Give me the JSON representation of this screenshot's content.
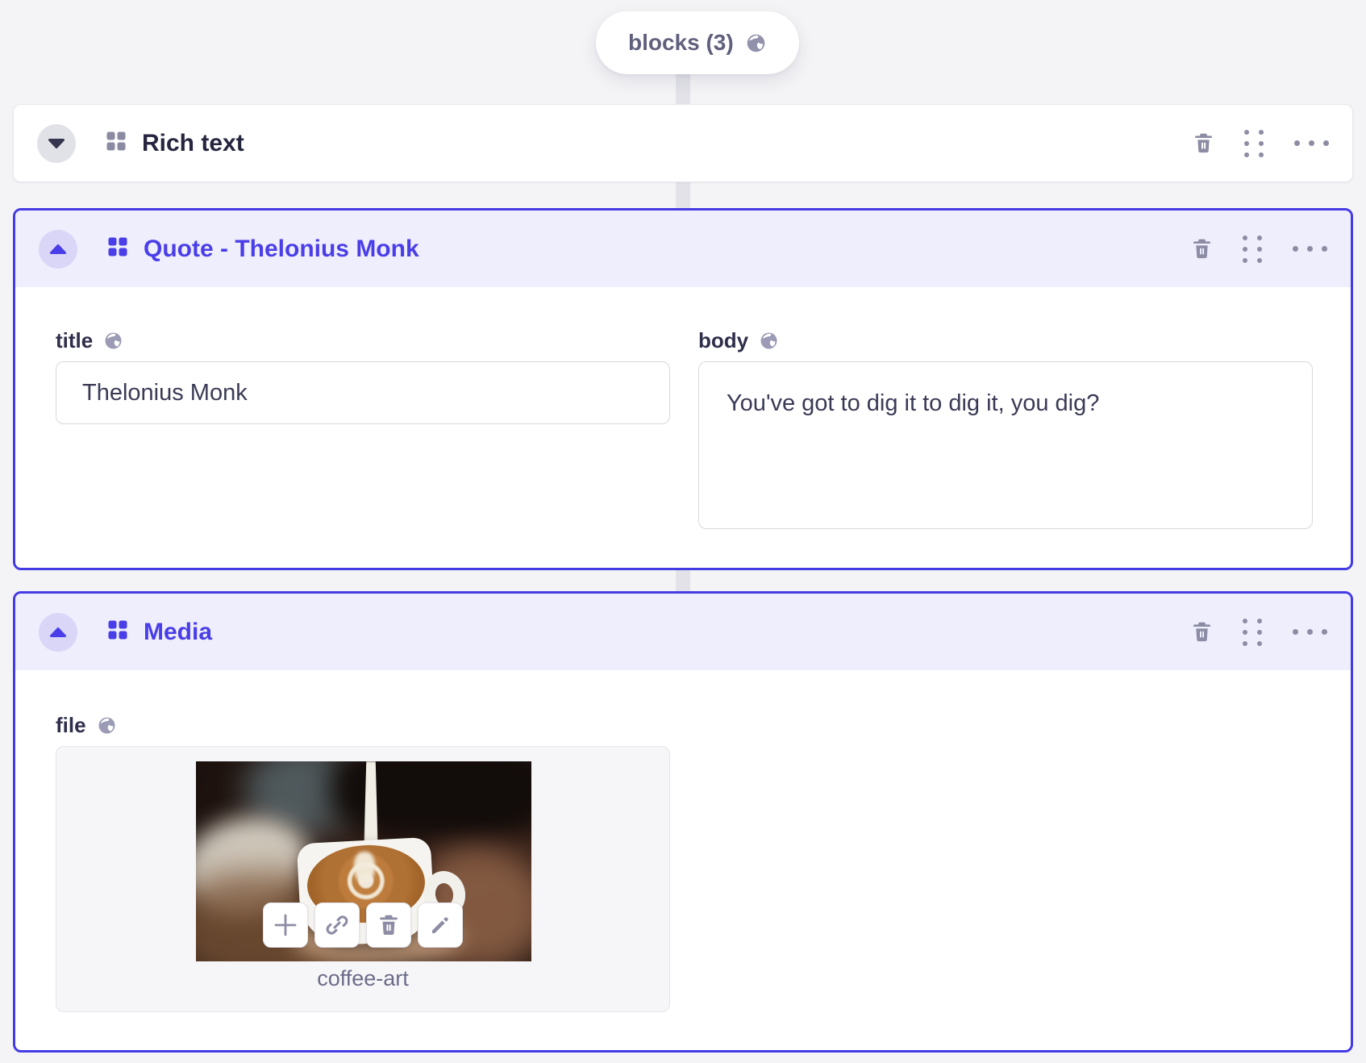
{
  "pill": {
    "label": "blocks (3)",
    "icon": "globe-icon"
  },
  "colors": {
    "accent_border": "#453BE5",
    "accent_text": "#4A3EE8",
    "selected_header_bg": "#EFEEFC",
    "slate_icon": "#8C8CA4",
    "page_bg": "#F4F4F6"
  },
  "block_actions": [
    "delete",
    "drag",
    "more"
  ],
  "blocks": {
    "rich_text": {
      "title": "Rich text",
      "state": "collapsed"
    },
    "quote": {
      "title": "Quote - Thelonius Monk",
      "state": "expanded",
      "fields": {
        "title": {
          "label": "title",
          "value": "Thelonius Monk",
          "localized": true
        },
        "body": {
          "label": "body",
          "value": "You've got to dig it to dig it, you dig?",
          "localized": true
        }
      }
    },
    "media": {
      "title": "Media",
      "state": "expanded",
      "fields": {
        "file": {
          "label": "file",
          "filename": "coffee-art",
          "localized": true,
          "toolbar": [
            "plus",
            "link",
            "trash",
            "pencil"
          ]
        }
      }
    }
  }
}
